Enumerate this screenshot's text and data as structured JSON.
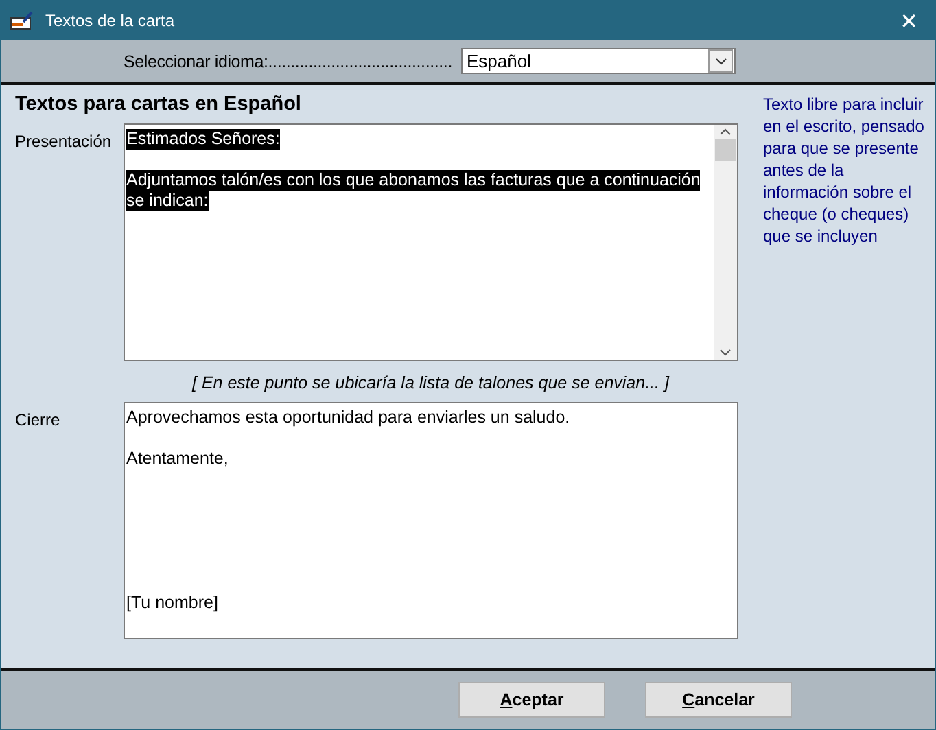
{
  "window": {
    "title": "Textos de la carta",
    "close": "✕"
  },
  "language": {
    "label": "Seleccionar idioma:.........................................",
    "value": "Español"
  },
  "heading": "Textos para cartas en Español",
  "help": "Texto libre para incluir en el escrito, pensado para que se presente antes de la información sobre el cheque (o cheques) que se incluyen",
  "presentation": {
    "label": "Presentación",
    "paragraphs": [
      {
        "kind": "body",
        "selected": true,
        "lines": [
          "Estimados Señores:"
        ]
      },
      {
        "kind": "body",
        "selected": true,
        "lines": [
          "Adjuntamos talón/es con los que abonamos las facturas que a continuación",
          "se indican:"
        ]
      }
    ]
  },
  "placeholder_note": "[ En este punto se ubicaría la lista de talones que se envian... ]",
  "closing": {
    "label": "Cierre",
    "paragraphs": [
      {
        "kind": "body",
        "selected": false,
        "lines": [
          "Aprovechamos esta oportunidad para enviarles un saludo."
        ]
      },
      {
        "kind": "body",
        "selected": false,
        "lines": [
          "Atentamente,"
        ]
      },
      {
        "kind": "signature",
        "selected": false,
        "lines": [
          "[Tu nombre]"
        ]
      }
    ]
  },
  "buttons": [
    {
      "label": "Aceptar",
      "mnemonic": true
    },
    {
      "label": "Cancelar",
      "mnemonic": true
    }
  ]
}
